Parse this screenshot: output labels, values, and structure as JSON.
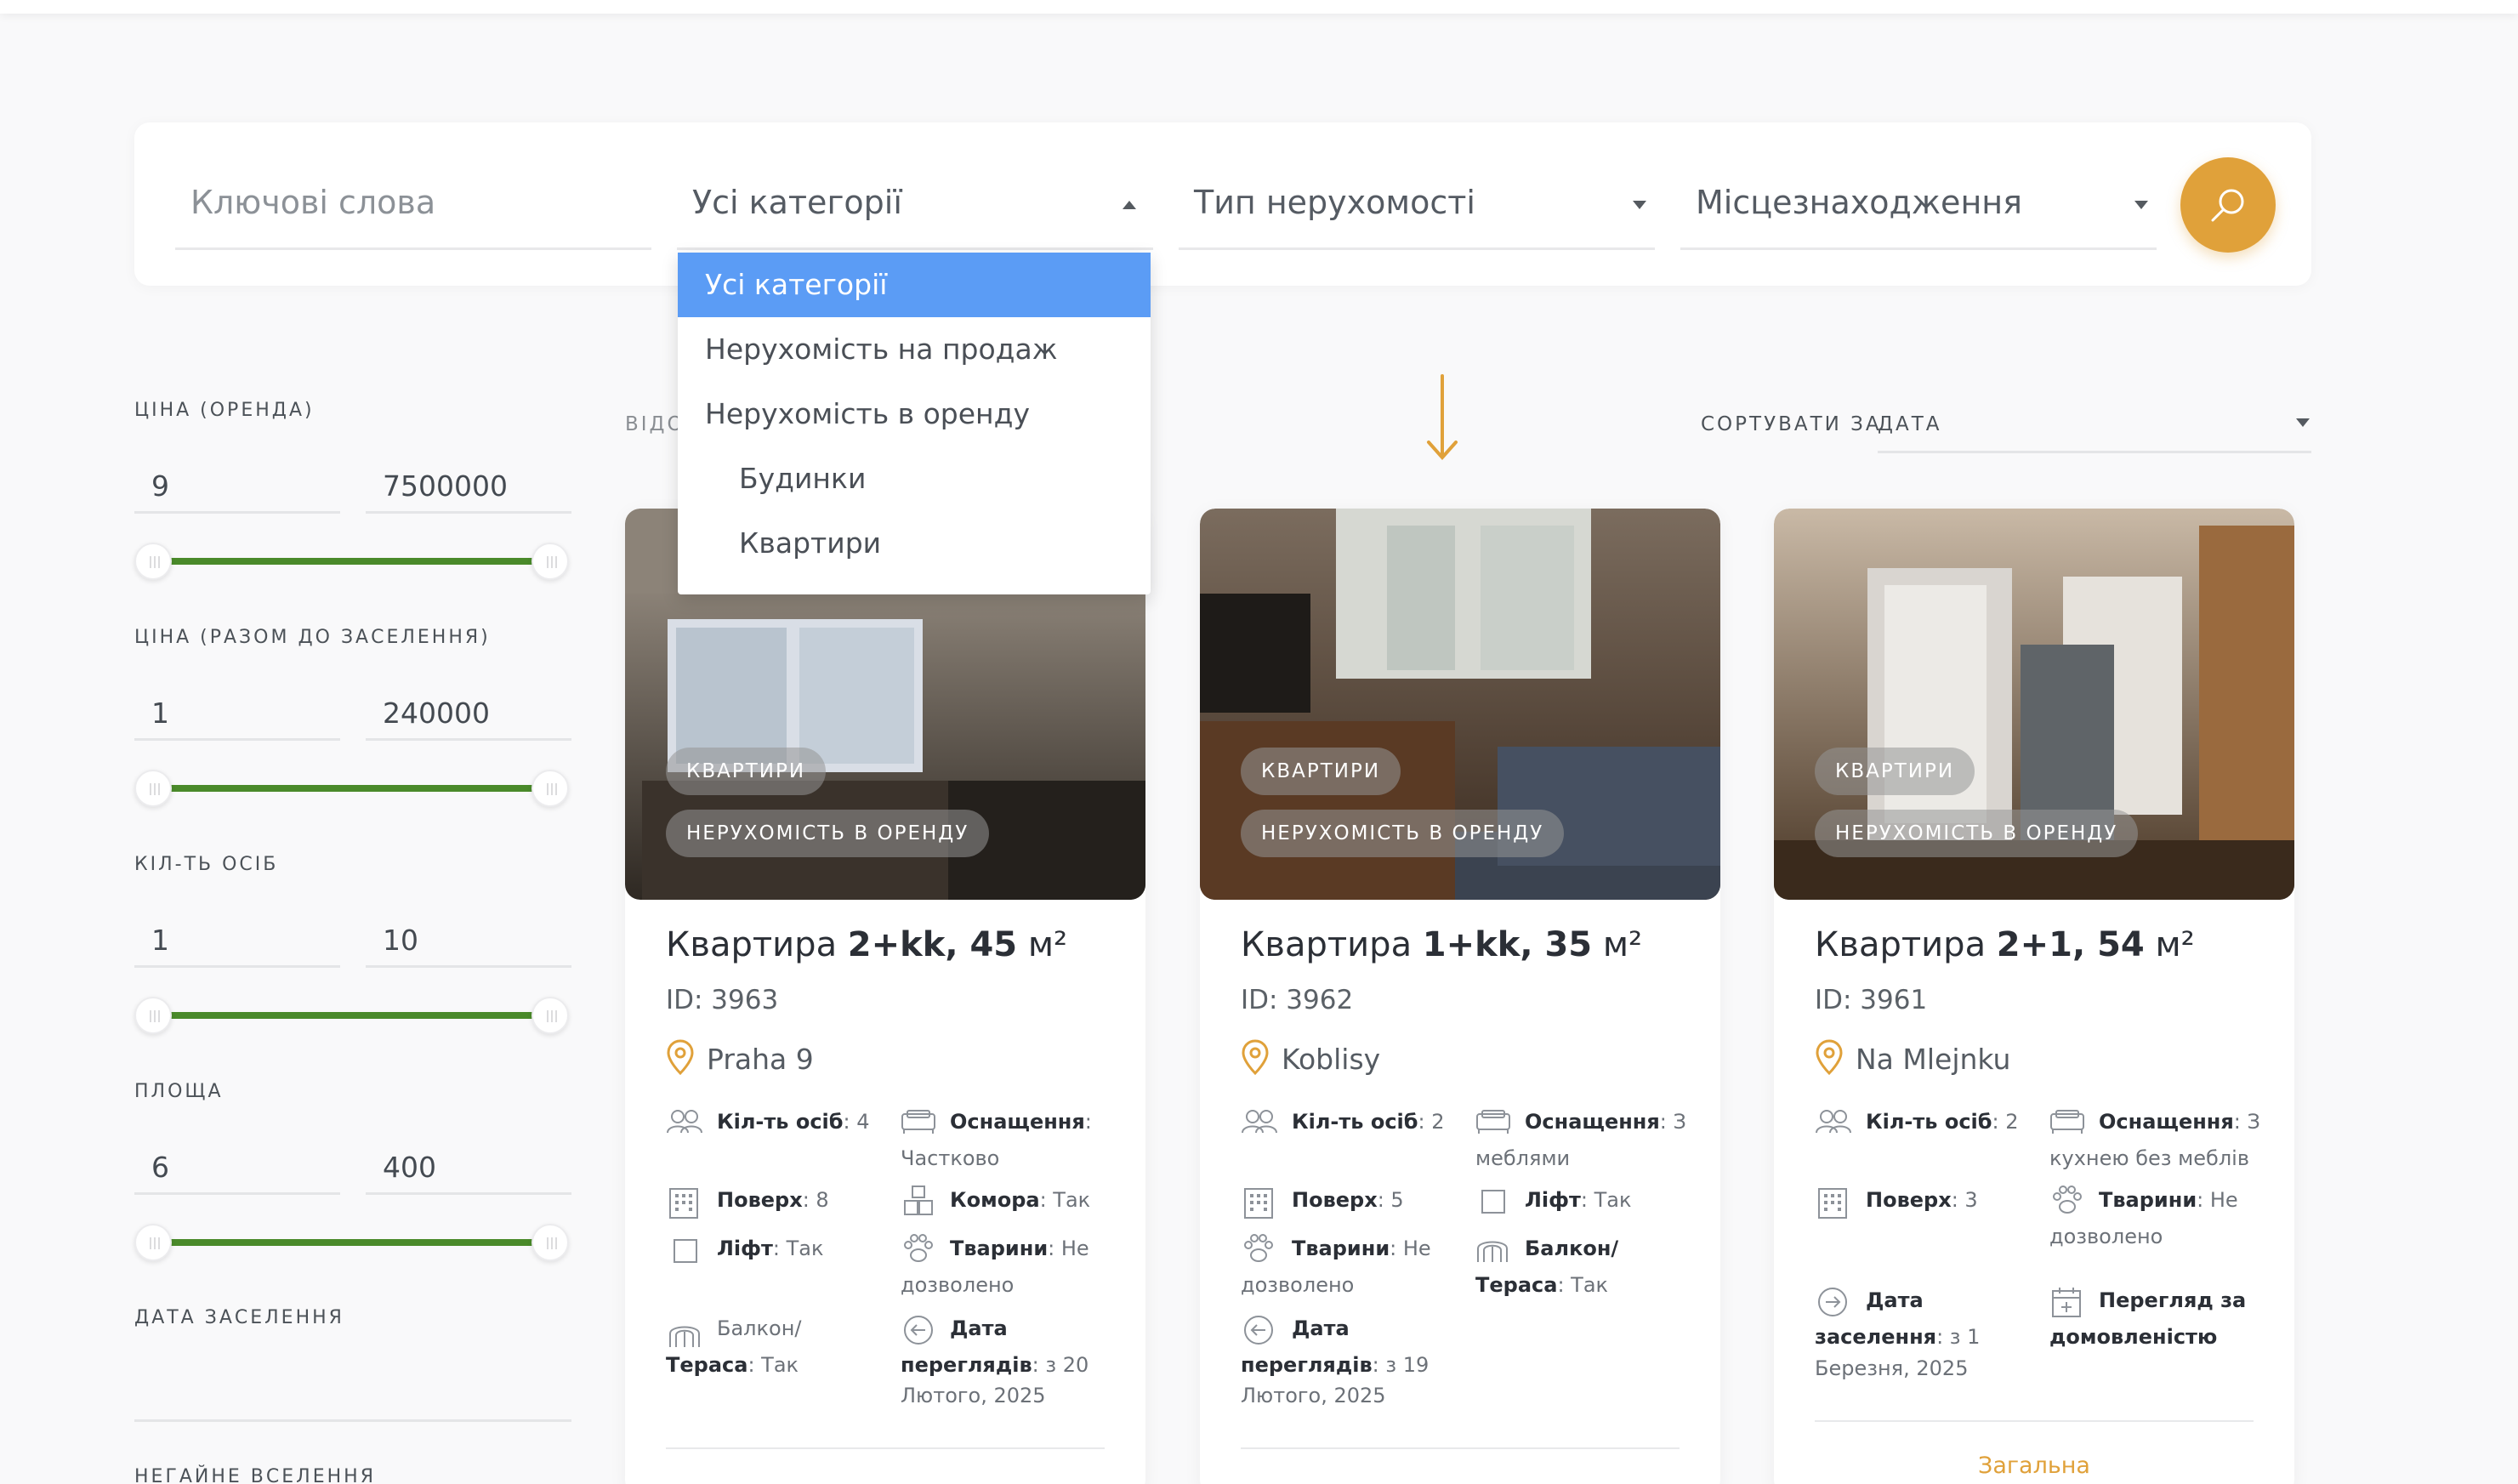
{
  "search": {
    "keywords_placeholder": "Ключові слова",
    "category_selected": "Усі категорії",
    "property_type": "Тип нерухомості",
    "location": "Місцезнаходження",
    "search_icon": "search-icon"
  },
  "category_dropdown": {
    "options": [
      "Усі категорії",
      "Нерухомість на продаж",
      "Нерухомість в оренду",
      "Будинки",
      "Квартири"
    ]
  },
  "filters": {
    "price_rent": {
      "label": "ЦІНА (ОРЕНДА)",
      "min": "9",
      "max": "7500000"
    },
    "price_total": {
      "label": "ЦІНА (РАЗОМ ДО ЗАСЕЛЕННЯ)",
      "min": "1",
      "max": "240000"
    },
    "persons": {
      "label": "КІЛ-ТЬ ОСІБ",
      "min": "1",
      "max": "10"
    },
    "area": {
      "label": "ПЛОЩА",
      "min": "6",
      "max": "400"
    },
    "move_in_date": {
      "label": "ДАТА ЗАСЕЛЕННЯ"
    },
    "immediate": {
      "label": "НЕГАЙНЕ ВСЕЛЕННЯ"
    }
  },
  "results": {
    "found_label": "ВІДО",
    "sort_label": "СОРТУВАТИ ЗА",
    "sort_value": "ДАТА"
  },
  "cards": [
    {
      "tag1": "КВАРТИРИ",
      "tag2": "НЕРУХОМІСТЬ В ОРЕНДУ",
      "title_prefix": "Квартира",
      "title_bold": "2+kk, 45",
      "title_unit": "м²",
      "id": "ID: 3963",
      "location": "Praha 9",
      "f1_b": "Кіл-ть осіб",
      "f1_v": ": 4",
      "f2_b": "Оснащення",
      "f2_v": ":",
      "f2_v2": "Частково",
      "f3_b": "Поверх",
      "f3_v": ": 8",
      "f4_b": "Комора",
      "f4_v": ": Так",
      "f5_b": "Ліфт",
      "f5_v": ": Так",
      "f6_b": "Тварини",
      "f6_v": ": Не",
      "f6_v2": "дозволено",
      "f7_b": "Балкон/",
      "f7_b2": "Тераса",
      "f7_v": ": Так",
      "f8_b": "Дата",
      "f8_b2": "переглядів",
      "f8_v": ": з 20",
      "f8_v2": "Лютого, 2025"
    },
    {
      "tag1": "КВАРТИРИ",
      "tag2": "НЕРУХОМІСТЬ В ОРЕНДУ",
      "title_prefix": "Квартира",
      "title_bold": "1+kk, 35",
      "title_unit": "м²",
      "id": "ID: 3962",
      "location": "Koblisy",
      "f1_b": "Кіл-ть осіб",
      "f1_v": ": 2",
      "f2_b": "Оснащення",
      "f2_v": ": З",
      "f2_v2": "меблями",
      "f3_b": "Поверх",
      "f3_v": ": 5",
      "f4_b": "Ліфт",
      "f4_v": ": Так",
      "f5_b": "Тварини",
      "f5_v": ": Не",
      "f5_v2": "дозволено",
      "f6_b": "Балкон/",
      "f6_b2": "Тераса",
      "f6_v": ": Так",
      "f7_b": "Дата",
      "f7_b2": "переглядів",
      "f7_v": ": з 19",
      "f7_v2": "Лютого, 2025"
    },
    {
      "tag1": "КВАРТИРИ",
      "tag2": "НЕРУХОМІСТЬ В ОРЕНДУ",
      "title_prefix": "Квартира",
      "title_bold": "2+1, 54",
      "title_unit": "м²",
      "id": "ID: 3961",
      "location": "Na Mlejnku",
      "f1_b": "Кіл-ть осіб",
      "f1_v": ": 2",
      "f2_b": "Оснащення",
      "f2_v": ": З",
      "f2_v2": "кухнею без меблів",
      "f3_b": "Поверх",
      "f3_v": ": 3",
      "f4_b": "Тварини",
      "f4_v": ": Не",
      "f4_v2": "дозволено",
      "f5_b": "Дата",
      "f5_b2": "заселення",
      "f5_v": ": з 1",
      "f5_v2": "Березня, 2025",
      "f6_b": "Перегляд за",
      "f6_b2": "домовленістю",
      "more": "Загальна"
    }
  ],
  "colors": {
    "accent": "#e0a13a",
    "slider": "#4a8a2a",
    "dropdown_selected": "#5b9cf5"
  }
}
